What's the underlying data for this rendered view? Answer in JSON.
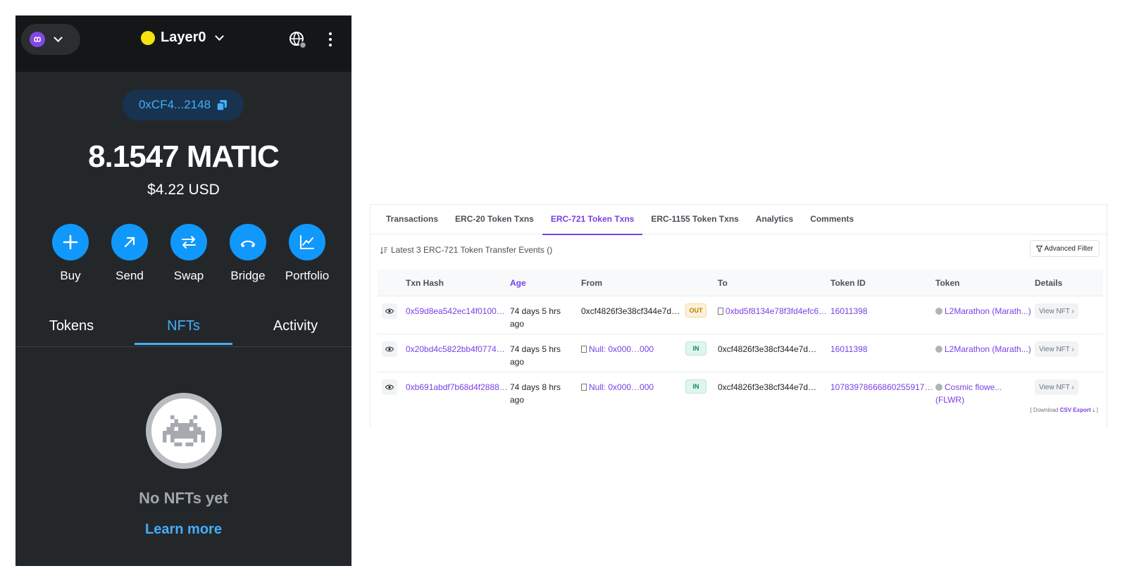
{
  "wallet": {
    "network_icon": "polygon-icon",
    "account_name": "Layer0",
    "address": "0xCF4...2148",
    "balance": "8.1547 MATIC",
    "fiat": "$4.22 USD",
    "actions": [
      {
        "label": "Buy",
        "icon": "plus-icon"
      },
      {
        "label": "Send",
        "icon": "arrow-up-right-icon"
      },
      {
        "label": "Swap",
        "icon": "swap-arrows-icon"
      },
      {
        "label": "Bridge",
        "icon": "bridge-icon"
      },
      {
        "label": "Portfolio",
        "icon": "chart-icon"
      }
    ],
    "tabs": [
      "Tokens",
      "NFTs",
      "Activity"
    ],
    "active_tab": "NFTs",
    "empty_title": "No NFTs yet",
    "learn_more": "Learn more",
    "colors": {
      "accent": "#43aefc",
      "button": "#1098fc",
      "bg": "#24272a"
    }
  },
  "explorer": {
    "tabs": [
      "Transactions",
      "ERC-20 Token Txns",
      "ERC-721 Token Txns",
      "ERC-1155 Token Txns",
      "Analytics",
      "Comments"
    ],
    "active_tab": "ERC-721 Token Txns",
    "summary": "Latest 3 ERC-721 Token Transfer Events ()",
    "advanced_filter": "Advanced Filter",
    "columns": [
      "Txn Hash",
      "Age",
      "From",
      "To",
      "Token ID",
      "Token",
      "Details"
    ],
    "rows": [
      {
        "hash": "0x59d8ea542ec14f0100…",
        "age_1": "74 days 5 hrs",
        "age_2": "ago",
        "from": "0xcf4826f3e38cf344e7d…",
        "direction": "OUT",
        "to": "0xbd5f8134e78f3fd4efc6…",
        "token_id": "16011398",
        "token": "L2Marathon (Marath...)",
        "token_2": "",
        "details": "View NFT ›"
      },
      {
        "hash": "0x20bd4c5822bb4f0774…",
        "age_1": "74 days 5 hrs",
        "age_2": "ago",
        "from": "Null: 0x000…000",
        "direction": "IN",
        "to": "0xcf4826f3e38cf344e7d…",
        "token_id": "16011398",
        "token": "L2Marathon (Marath...)",
        "token_2": "",
        "details": "View NFT ›"
      },
      {
        "hash": "0xb691abdf7b68d4f2888…",
        "age_1": "74 days 8 hrs",
        "age_2": "ago",
        "from": "Null: 0x000…000",
        "direction": "IN",
        "to": "0xcf4826f3e38cf344e7d…",
        "token_id": "10783978666860255917…",
        "token": "Cosmic flowe...",
        "token_2": "(FLWR)",
        "details": "View NFT ›"
      }
    ],
    "download_prefix": "[ Download",
    "download_link": "CSV Export",
    "download_suffix": "]",
    "colors": {
      "accent": "#7b3fe4"
    }
  }
}
